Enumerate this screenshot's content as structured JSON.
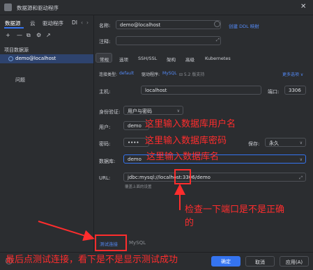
{
  "window": {
    "title": "数据源和驱动程序",
    "close_symbol": "✕"
  },
  "left": {
    "tabs": [
      "数据源",
      "云",
      "驱动程序",
      "DI"
    ],
    "tools": [
      "+",
      "—",
      "⧉",
      "⚙",
      "↗"
    ],
    "section_label": "项目数据源",
    "datasource": "demo@localhost",
    "issues": "问题"
  },
  "form": {
    "name_label": "名称:",
    "name_value": "demo@localhost",
    "create_ddl_link": "创建 DDL 映射",
    "comment_label": "注释:",
    "tabs": [
      "常规",
      "选项",
      "SSH/SSL",
      "架构",
      "高级",
      "Kubernetes"
    ],
    "conn_type_label": "连接类型:",
    "conn_type_value": "default",
    "driver_label": "驱动程序:",
    "driver_value": "MySQL",
    "driver_extra": "⊟ 5.2 版支持",
    "more_options": "更多选项 ∨",
    "host_label": "主机:",
    "host_value": "localhost",
    "port_label": "端口:",
    "port_value": "3306",
    "auth_label": "身份验证:",
    "auth_value": "用户与密码",
    "user_label": "用户:",
    "user_value": "demo",
    "password_label": "密码:",
    "password_value": "••••",
    "save_label": "保存:",
    "save_value": "永久",
    "db_label": "数据库:",
    "db_value": "demo",
    "url_label": "URL:",
    "url_value": "jdbc:mysql://localhost:3306/demo",
    "url_hint": "覆盖上面的设置",
    "test_connection": "测试连接",
    "test_driver": "MySQL"
  },
  "footer": {
    "ok": "确定",
    "cancel": "取消",
    "apply": "应用(A)"
  },
  "annotations": {
    "user": "这里输入数据库用户名",
    "password": "这里输入数据库密码",
    "database": "这里输入数据库名",
    "port": "检查一下端口是不是正确",
    "port_line2": "的",
    "test": "最后点测试连接，看下是不是显示测试成功"
  },
  "colors": {
    "accent": "#3574f0",
    "annotation": "#ff2d2d",
    "background": "#2b2d30"
  }
}
